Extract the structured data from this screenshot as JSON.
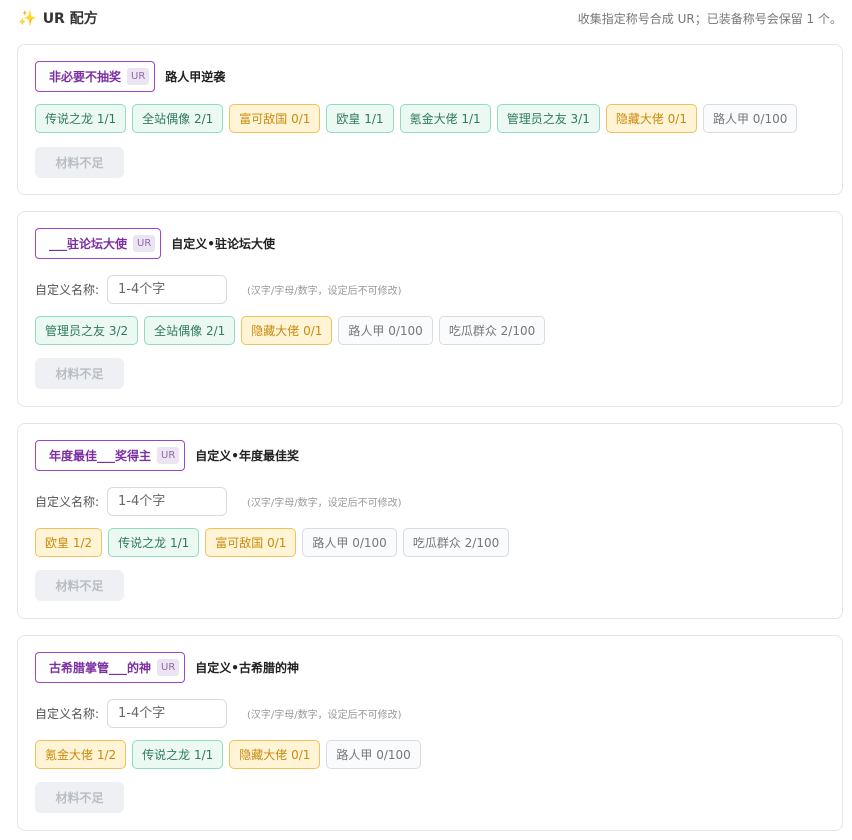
{
  "header": {
    "icon": "sparkle-icon",
    "title": "UR 配方",
    "note": "收集指定称号合成 UR；已装备称号会保留 1 个。"
  },
  "labels": {
    "name_label": "自定义名称:",
    "name_placeholder": "1-4个字",
    "name_hint": "(汉字/字母/数字，设定后不可修改)",
    "ur_tag": "UR",
    "button": "材料不足"
  },
  "recipes": [
    {
      "title": "非必要不抽奖",
      "desc": "路人甲逆袭",
      "materials": [
        {
          "label": "传说之龙 1/1",
          "state": "ok"
        },
        {
          "label": "全站偶像 2/1",
          "state": "ok"
        },
        {
          "label": "富可敌国 0/1",
          "state": "warn"
        },
        {
          "label": "欧皇 1/1",
          "state": "ok"
        },
        {
          "label": "氪金大佬 1/1",
          "state": "ok"
        },
        {
          "label": "管理员之友 3/1",
          "state": "ok"
        },
        {
          "label": "隐藏大佬 0/1",
          "state": "warn"
        },
        {
          "label": "路人甲 0/100",
          "state": "none"
        }
      ]
    },
    {
      "title": "___驻论坛大使",
      "desc": "自定义•驻论坛大使",
      "materials": [
        {
          "label": "管理员之友 3/2",
          "state": "ok"
        },
        {
          "label": "全站偶像 2/1",
          "state": "ok"
        },
        {
          "label": "隐藏大佬 0/1",
          "state": "warn"
        },
        {
          "label": "路人甲 0/100",
          "state": "none"
        },
        {
          "label": "吃瓜群众 2/100",
          "state": "none"
        }
      ]
    },
    {
      "title": "年度最佳___奖得主",
      "desc": "自定义•年度最佳奖",
      "materials": [
        {
          "label": "欧皇 1/2",
          "state": "warn"
        },
        {
          "label": "传说之龙 1/1",
          "state": "ok"
        },
        {
          "label": "富可敌国 0/1",
          "state": "warn"
        },
        {
          "label": "路人甲 0/100",
          "state": "none"
        },
        {
          "label": "吃瓜群众 2/100",
          "state": "none"
        }
      ]
    },
    {
      "title": "古希腊掌管___的神",
      "desc": "自定义•古希腊的神",
      "materials": [
        {
          "label": "氪金大佬 1/2",
          "state": "warn"
        },
        {
          "label": "传说之龙 1/1",
          "state": "ok"
        },
        {
          "label": "隐藏大佬 0/1",
          "state": "warn"
        },
        {
          "label": "路人甲 0/100",
          "state": "none"
        }
      ]
    }
  ]
}
